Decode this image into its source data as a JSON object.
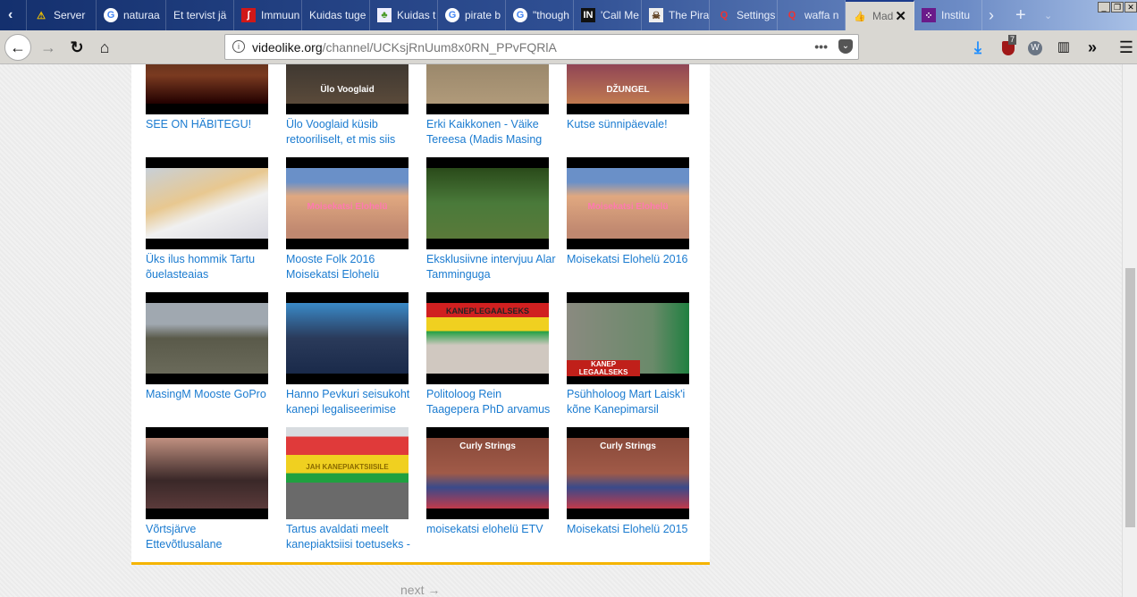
{
  "tabs": [
    {
      "label": "Server",
      "icon": "warning-icon"
    },
    {
      "label": "naturaa",
      "icon": "google-icon"
    },
    {
      "label": "Et tervist jä",
      "icon": ""
    },
    {
      "label": "Immuun",
      "icon": "site-icon"
    },
    {
      "label": "Kuidas tuge",
      "icon": ""
    },
    {
      "label": "Kuidas t",
      "icon": "plant-icon"
    },
    {
      "label": "pirate b",
      "icon": "google-icon"
    },
    {
      "label": "\"though",
      "icon": "google-icon"
    },
    {
      "label": "'Call Me",
      "icon": "in-icon"
    },
    {
      "label": "The Pira",
      "icon": "pirate-icon"
    },
    {
      "label": "Settings",
      "icon": "q-icon"
    },
    {
      "label": "waffa n",
      "icon": "q-icon"
    },
    {
      "label": "Mad",
      "icon": "thumbs-up-icon"
    },
    {
      "label": "Institu",
      "icon": "institute-icon"
    }
  ],
  "address": {
    "host": "videolike.org",
    "path": "/channel/UCKsjRnUum8x0RN_PPvFQRlA"
  },
  "badge_count": "7",
  "videos": [
    {
      "title": "SEE ON HÄBITEGU!",
      "caption": ""
    },
    {
      "title": "Ülo Vooglaid küsib retooriliselt, et mis siis",
      "caption": "Ülo Vooglaid"
    },
    {
      "title": "Erki Kaikkonen - Väike Tereesa (Madis Masing",
      "caption": ""
    },
    {
      "title": "Kutse sünnipäevale!",
      "caption": "DŽUNGEL"
    },
    {
      "title": "Üks ilus hommik Tartu õuelasteaias",
      "caption": ""
    },
    {
      "title": "Mooste Folk 2016 Moisekatsi Elohelü",
      "caption": "Moisekatsi Elohelü"
    },
    {
      "title": "Eksklusiivne intervjuu Alar Tamminguga",
      "caption": ""
    },
    {
      "title": "Moisekatsi Elohelü 2016",
      "caption": "Moisekatsi Elohelü"
    },
    {
      "title": "MasingM Mooste GoPro",
      "caption": ""
    },
    {
      "title": "Hanno Pevkuri seisukoht kanepi legaliseerimise",
      "caption": ""
    },
    {
      "title": "Politoloog Rein Taagepera PhD arvamus",
      "caption": "KANEPLEGAALSEKS"
    },
    {
      "title": "Psühholoog Mart Laisk'i kõne Kanepimarsil",
      "caption": "KANEP LEGAALSEKS"
    },
    {
      "title": "Võrtsjärve Ettevõtlusalane Noortefoorum",
      "caption": ""
    },
    {
      "title": "Tartus avaldati meelt kanepiaktsiisi toetuseks -",
      "caption": "JAH KANEPIAKTSIISILE"
    },
    {
      "title": "moisekatsi elohelü ETV",
      "caption": "Curly Strings"
    },
    {
      "title": "Moisekatsi Elohelü 2015",
      "caption": "Curly Strings"
    }
  ],
  "next_label": "next →"
}
